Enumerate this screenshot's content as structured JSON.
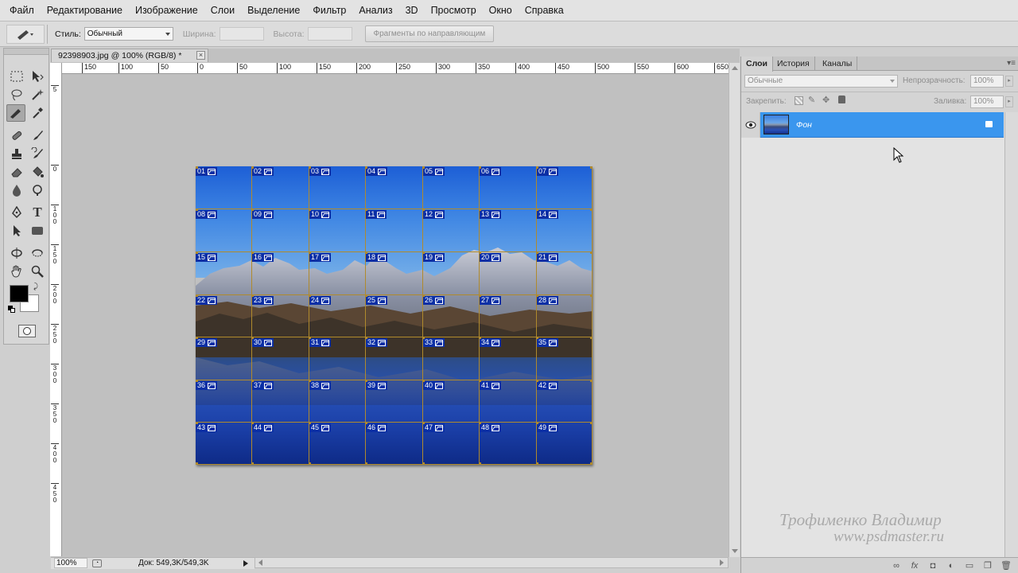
{
  "menu": [
    "Файл",
    "Редактирование",
    "Изображение",
    "Слои",
    "Выделение",
    "Фильтр",
    "Анализ",
    "3D",
    "Просмотр",
    "Окно",
    "Справка"
  ],
  "options": {
    "style_label": "Стиль:",
    "style_value": "Обычный",
    "width_label": "Ширина:",
    "height_label": "Высота:",
    "slices_button": "Фрагменты по направляющим"
  },
  "document": {
    "tab_title": "92398903.jpg @ 100% (RGB/8) *",
    "close": "×"
  },
  "ruler": {
    "h_labels": [
      "150",
      "100",
      "50",
      "0",
      "50",
      "100",
      "150",
      "200",
      "250",
      "300",
      "350",
      "400",
      "450",
      "500",
      "550",
      "600",
      "650"
    ],
    "v_labels": [
      "5",
      "0",
      "1\n0\n0",
      "1\n5\n0",
      "2\n0\n0",
      "2\n5\n0",
      "3\n0\n0",
      "3\n5\n0",
      "4\n0\n0",
      "4\n5\n0"
    ]
  },
  "slices": [
    "01",
    "02",
    "03",
    "04",
    "05",
    "06",
    "07",
    "08",
    "09",
    "10",
    "11",
    "12",
    "13",
    "14",
    "15",
    "16",
    "17",
    "18",
    "19",
    "20",
    "21",
    "22",
    "23",
    "24",
    "25",
    "26",
    "27",
    "28",
    "29",
    "30",
    "31",
    "32",
    "33",
    "34",
    "35",
    "36",
    "37",
    "38",
    "39",
    "40",
    "41",
    "42",
    "43",
    "44",
    "45",
    "46",
    "47",
    "48",
    "49"
  ],
  "status": {
    "zoom": "100%",
    "doc_info": "Док: 549,3K/549,3K"
  },
  "panel": {
    "tabs": [
      "Слои",
      "История",
      "Каналы"
    ],
    "blend_mode": "Обычные",
    "opacity_label": "Непрозрачность:",
    "opacity_value": "100%",
    "lock_label": "Закрепить:",
    "fill_label": "Заливка:",
    "fill_value": "100%",
    "layer_name": "Фон"
  },
  "watermark": {
    "line1": "Трофименко Владимир",
    "line2": "www.psdmaster.ru"
  },
  "colors": {
    "selection": "#3a96ee",
    "slice_badge": "#0b2fa5",
    "slice_line": "#b08a2c"
  }
}
